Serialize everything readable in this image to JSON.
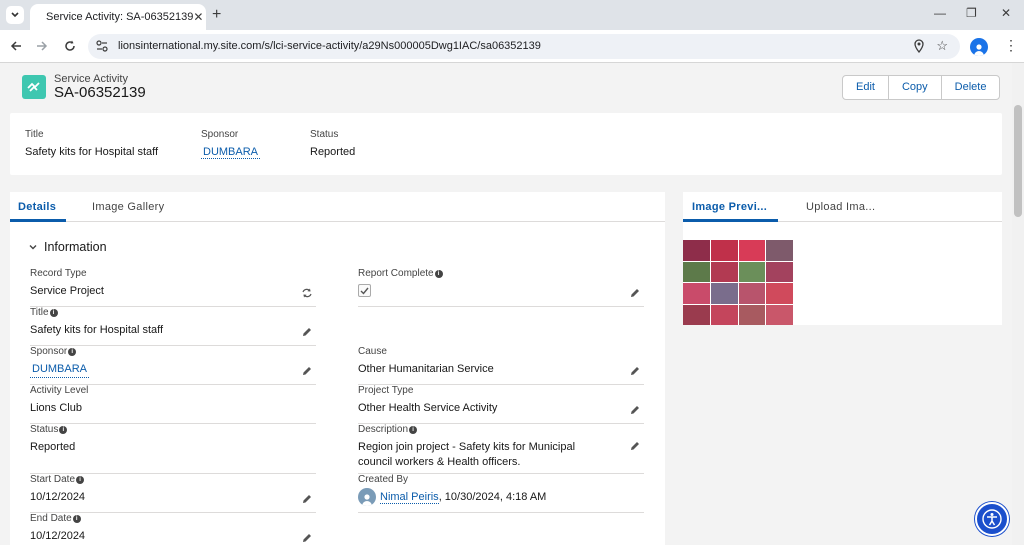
{
  "browser": {
    "tab_title": "Service Activity: SA-06352139",
    "url": "lionsinternational.my.site.com/s/lci-service-activity/a29Ns000005Dwg1IAC/sa06352139"
  },
  "record": {
    "object_type": "Service Activity",
    "name": "SA-06352139",
    "actions": {
      "edit": "Edit",
      "copy": "Copy",
      "delete": "Delete"
    }
  },
  "highlights": {
    "title_label": "Title",
    "title_value": "Safety kits for Hospital staff",
    "sponsor_label": "Sponsor",
    "sponsor_value": "DUMBARA",
    "status_label": "Status",
    "status_value": "Reported"
  },
  "main_tabs": {
    "details": "Details",
    "gallery": "Image Gallery"
  },
  "section": {
    "title": "Information"
  },
  "fields": {
    "record_type": {
      "label": "Record Type",
      "value": "Service Project"
    },
    "title": {
      "label": "Title",
      "value": "Safety kits for Hospital staff"
    },
    "sponsor": {
      "label": "Sponsor",
      "value": "DUMBARA"
    },
    "activity_level": {
      "label": "Activity Level",
      "value": "Lions Club"
    },
    "status": {
      "label": "Status",
      "value": "Reported"
    },
    "start_date": {
      "label": "Start Date",
      "value": "10/12/2024"
    },
    "end_date": {
      "label": "End Date",
      "value": "10/12/2024"
    },
    "report_complete": {
      "label": "Report Complete",
      "checked": true
    },
    "cause": {
      "label": "Cause",
      "value": "Other Humanitarian Service"
    },
    "project_type": {
      "label": "Project Type",
      "value": "Other Health Service Activity"
    },
    "description": {
      "label": "Description",
      "value": "Region join project - Safety kits for Municipal council workers & Health officers."
    },
    "created_by": {
      "label": "Created By",
      "user": "Nimal Peiris",
      "timestamp": ", 10/30/2024, 4:18 AM"
    }
  },
  "side_tabs": {
    "preview": "Image Previ...",
    "upload": "Upload Ima..."
  },
  "colors": {
    "brand_blue": "#0b5cab",
    "object_icon": "#3ec7b0",
    "a11y_button": "#1b4fcc"
  }
}
